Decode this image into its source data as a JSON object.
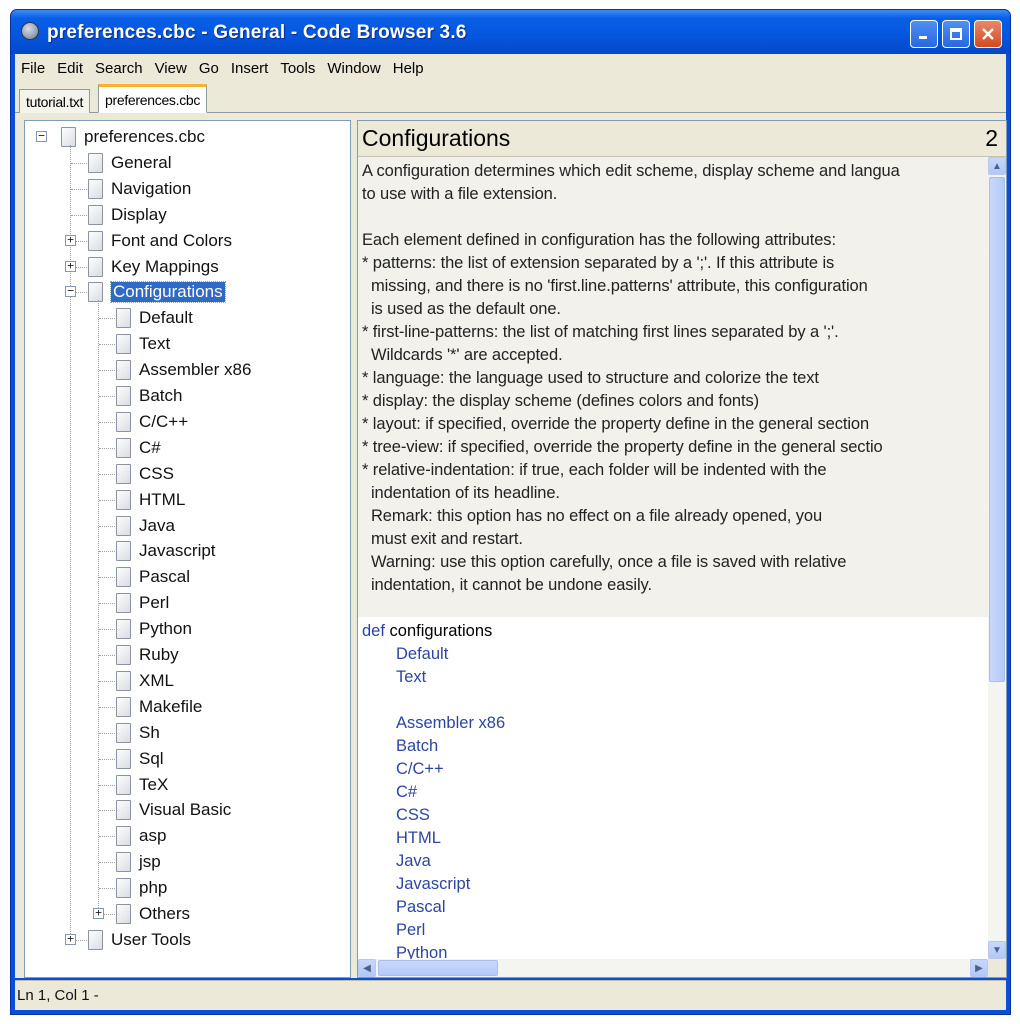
{
  "window": {
    "title": "preferences.cbc - General - Code Browser 3.6"
  },
  "menu": [
    "File",
    "Edit",
    "Search",
    "View",
    "Go",
    "Insert",
    "Tools",
    "Window",
    "Help"
  ],
  "tabs": [
    "tutorial.txt",
    "preferences.cbc"
  ],
  "active_tab": "preferences.cbc",
  "tree": {
    "root": "preferences.cbc",
    "level1": [
      "General",
      "Navigation",
      "Display",
      "Font and Colors",
      "Key Mappings",
      "Configurations"
    ],
    "selected": "Configurations",
    "configurations": [
      "Default",
      "Text",
      "Assembler x86",
      "Batch",
      "C/C++",
      "C#",
      "CSS",
      "HTML",
      "Java",
      "Javascript",
      "Pascal",
      "Perl",
      "Python",
      "Ruby",
      "XML",
      "Makefile",
      "Sh",
      "Sql",
      "TeX",
      "Visual Basic",
      "asp",
      "jsp",
      "php",
      "Others"
    ],
    "last": "User Tools"
  },
  "editor": {
    "heading": "Configurations",
    "heading_number": "2",
    "doc_lines": [
      "A configuration determines which edit scheme, display scheme and langua",
      "to use with a file extension.",
      "",
      "Each element defined in configuration has the following attributes:",
      "* patterns: the list of extension separated by a ';'. If this attribute is",
      "  missing, and there is no 'first.line.patterns' attribute, this configuration",
      "  is used as the default one.",
      "* first-line-patterns: the list of matching first lines separated by a ';'.",
      "  Wildcards '*' are accepted.",
      "* language: the language used to structure and colorize the text",
      "* display: the display scheme (defines colors and fonts)",
      "* layout: if specified, override the property define in the general section",
      "* tree-view: if specified, override the property define in the general sectio",
      "* relative-indentation: if true, each folder will be indented with the",
      "  indentation of its headline.",
      "  Remark: this option has no effect on a file already opened, you",
      "  must exit and restart.",
      "  Warning: use this option carefully, once a file is saved with relative",
      "  indentation, it cannot be undone easily."
    ],
    "code_keyword": "def",
    "code_name": "configurations",
    "code_children": [
      "Default",
      "Text",
      "",
      "Assembler x86",
      "Batch",
      "C/C++",
      "C#",
      "CSS",
      "HTML",
      "Java",
      "Javascript",
      "Pascal",
      "Perl",
      "Python"
    ]
  },
  "status": {
    "text": "Ln 1, Col 1 -"
  },
  "icons": [
    "app-icon",
    "minimize-icon",
    "maximize-icon",
    "close-icon",
    "document-icon",
    "expand-icon",
    "collapse-icon",
    "scroll-up-icon",
    "scroll-down-icon",
    "scroll-left-icon",
    "scroll-right-icon"
  ]
}
